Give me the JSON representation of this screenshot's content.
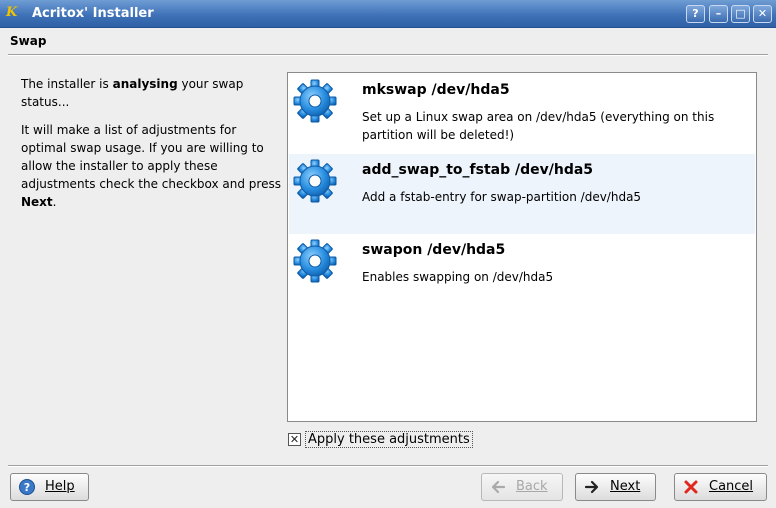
{
  "window": {
    "title": "Acritox' Installer",
    "app_icon_glyph": "K",
    "controls": {
      "help": "?",
      "minimize": "–",
      "maximize": "□",
      "close": "✕"
    }
  },
  "page": {
    "header": "Swap"
  },
  "description": {
    "p1_pre": "The installer is ",
    "p1_bold": "analysing",
    "p1_post": " your swap status...",
    "p2_pre": "It will make a list of adjustments for optimal swap usage. If you are willing to allow the installer to apply these adjustments check the checkbox and press ",
    "p2_bold": "Next",
    "p2_post": "."
  },
  "adjustments": [
    {
      "name": "mkswap /dev/hda5",
      "detail": "Set up a Linux swap area on /dev/hda5 (everything on this partition will be deleted!)",
      "icon": "gear-icon"
    },
    {
      "name": "add_swap_to_fstab /dev/hda5",
      "detail": "Add a fstab-entry for swap-partition /dev/hda5",
      "icon": "gear-icon"
    },
    {
      "name": "swapon /dev/hda5",
      "detail": "Enables swapping on /dev/hda5",
      "icon": "gear-icon"
    }
  ],
  "checkbox": {
    "label": "Apply these adjustments",
    "checked": true,
    "mark": "✕"
  },
  "buttons": {
    "help": "Help",
    "back": "Back",
    "next": "Next",
    "cancel": "Cancel"
  },
  "colors": {
    "titlebar": "#3f72b8",
    "gear": "#2a8fe0",
    "selected_row": "#eef4fb"
  }
}
